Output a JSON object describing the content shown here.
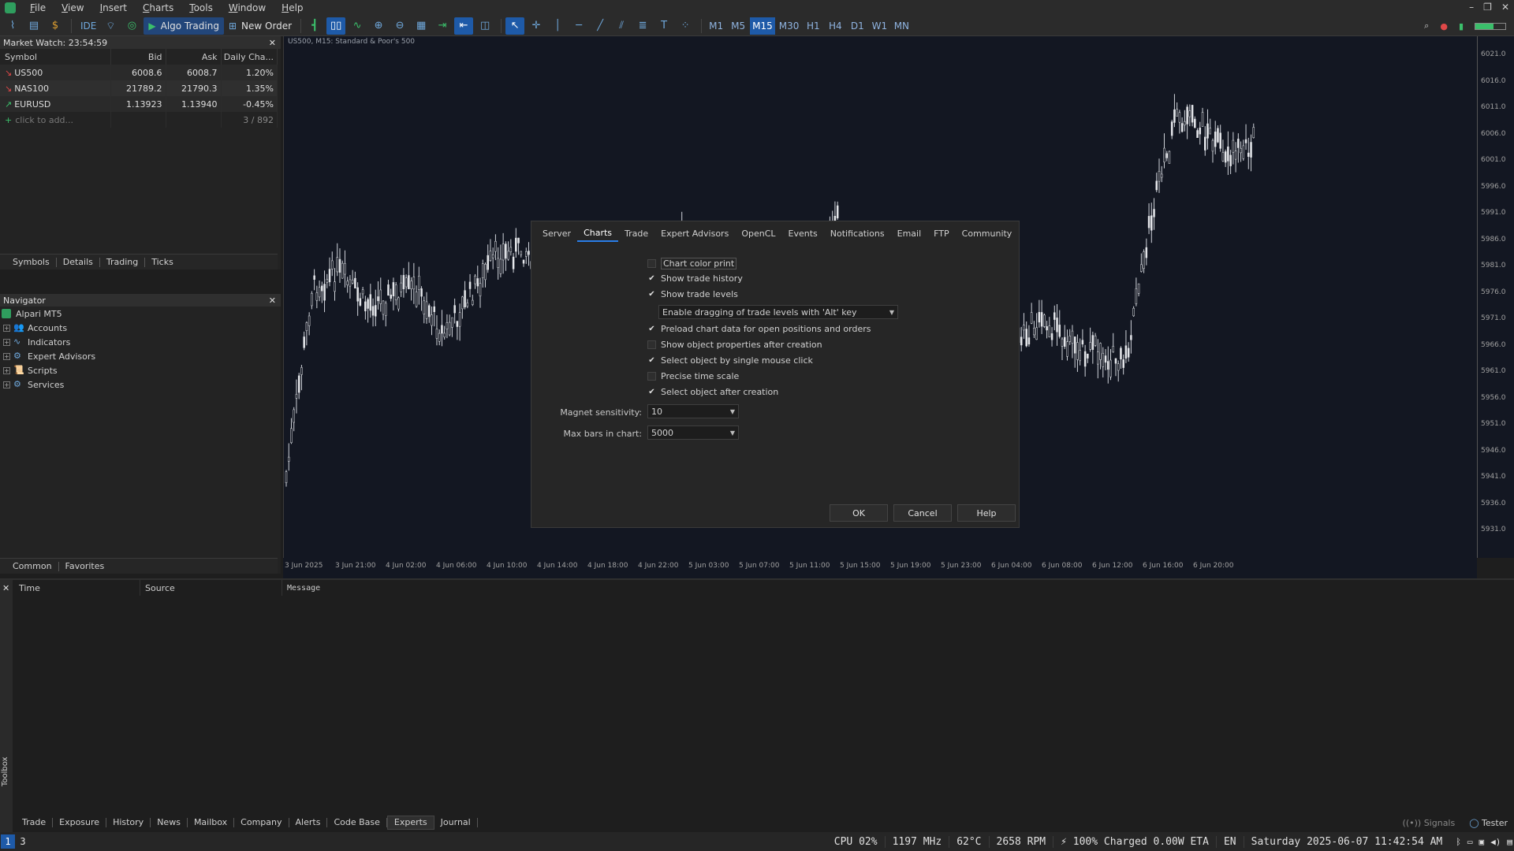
{
  "menu": [
    "File",
    "View",
    "Insert",
    "Charts",
    "Tools",
    "Window",
    "Help"
  ],
  "toolbar": {
    "ide_label": "IDE",
    "algo_label": "Algo Trading",
    "new_order_label": "New Order",
    "timeframes": [
      "M1",
      "M5",
      "M15",
      "M30",
      "H1",
      "H4",
      "D1",
      "W1",
      "MN"
    ],
    "active_timeframe": "M15"
  },
  "market_watch": {
    "title": "Market Watch: 23:54:59",
    "columns": [
      "Symbol",
      "Bid",
      "Ask",
      "Daily Cha..."
    ],
    "rows": [
      {
        "symbol": "US500",
        "bid": "6008.6",
        "ask": "6008.7",
        "change": "1.20%",
        "direction": "down"
      },
      {
        "symbol": "NAS100",
        "bid": "21789.2",
        "ask": "21790.3",
        "change": "1.35%",
        "direction": "down"
      },
      {
        "symbol": "EURUSD",
        "bid": "1.13923",
        "ask": "1.13940",
        "change": "-0.45%",
        "direction": "up"
      }
    ],
    "add_label": "click to add...",
    "count": "3 / 892",
    "tabs": [
      "Symbols",
      "Details",
      "Trading",
      "Ticks"
    ]
  },
  "navigator": {
    "title": "Navigator",
    "root": "Alpari MT5",
    "items": [
      "Accounts",
      "Indicators",
      "Expert Advisors",
      "Scripts",
      "Services"
    ],
    "tabs": [
      "Common",
      "Favorites"
    ]
  },
  "chart": {
    "label": "US500, M15:  Standard & Poor's 500",
    "price_ticks": [
      "6021.0",
      "6016.0",
      "6011.0",
      "6006.0",
      "6001.0",
      "5996.0",
      "5991.0",
      "5986.0",
      "5981.0",
      "5976.0",
      "5971.0",
      "5966.0",
      "5961.0",
      "5956.0",
      "5951.0",
      "5946.0",
      "5941.0",
      "5936.0",
      "5931.0"
    ],
    "time_ticks": [
      "3 Jun 2025",
      "3 Jun 21:00",
      "4 Jun 02:00",
      "4 Jun 06:00",
      "4 Jun 10:00",
      "4 Jun 14:00",
      "4 Jun 18:00",
      "4 Jun 22:00",
      "5 Jun 03:00",
      "5 Jun 07:00",
      "5 Jun 11:00",
      "5 Jun 15:00",
      "5 Jun 19:00",
      "5 Jun 23:00",
      "6 Jun 04:00",
      "6 Jun 08:00",
      "6 Jun 12:00",
      "6 Jun 16:00",
      "6 Jun 20:00"
    ]
  },
  "dialog": {
    "tabs": [
      "Server",
      "Charts",
      "Trade",
      "Expert Advisors",
      "OpenCL",
      "Events",
      "Notifications",
      "Email",
      "FTP",
      "Community"
    ],
    "active_tab": "Charts",
    "options": [
      {
        "label": "Chart color print",
        "checked": false
      },
      {
        "label": "Show trade history",
        "checked": true
      },
      {
        "label": "Show trade levels",
        "checked": true
      },
      {
        "label": "Preload chart data for open positions and orders",
        "checked": true
      },
      {
        "label": "Show object properties after creation",
        "checked": false
      },
      {
        "label": "Select object by single mouse click",
        "checked": true
      },
      {
        "label": "Precise time scale",
        "checked": false
      },
      {
        "label": "Select object after creation",
        "checked": true
      }
    ],
    "drag_select": "Enable dragging of trade levels with 'Alt' key",
    "magnet_label": "Magnet sensitivity:",
    "magnet_value": "10",
    "maxbars_label": "Max bars in chart:",
    "maxbars_value": "5000",
    "ok": "OK",
    "cancel": "Cancel",
    "help": "Help"
  },
  "toolbox": {
    "side_label": "Toolbox",
    "columns": [
      "Time",
      "Source",
      "Message"
    ],
    "tabs": [
      "Trade",
      "Exposure",
      "History",
      "News",
      "Mailbox",
      "Company",
      "Alerts",
      "Code Base",
      "Experts",
      "Journal"
    ],
    "active_tab": "Experts",
    "signals": "Signals",
    "tester": "Tester"
  },
  "statusbar": {
    "workspace_active": "1",
    "workspace_other": "3",
    "cpu": "CPU 02%",
    "mhz": "1197 MHz",
    "temp": "62°C",
    "rpm": "2658 RPM",
    "battery": "⚡ 100% Charged 0.00W ETA",
    "lang": "EN",
    "datetime": "Saturday 2025-06-07 11:42:54 AM"
  }
}
